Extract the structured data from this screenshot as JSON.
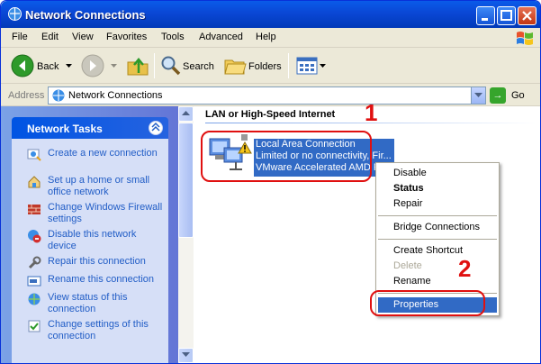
{
  "window": {
    "title": "Network Connections"
  },
  "menubar": [
    "File",
    "Edit",
    "View",
    "Favorites",
    "Tools",
    "Advanced",
    "Help"
  ],
  "toolbar": {
    "back": "Back",
    "search": "Search",
    "folders": "Folders"
  },
  "address": {
    "label": "Address",
    "value": "Network Connections",
    "go": "Go"
  },
  "tasks": {
    "title": "Network Tasks",
    "items": [
      {
        "label": "Create a new connection",
        "icon": "new-connection-icon"
      },
      {
        "label": "Set up a home or small office network",
        "icon": "home-network-icon"
      },
      {
        "label": "Change Windows Firewall settings",
        "icon": "firewall-icon"
      },
      {
        "label": "Disable this network device",
        "icon": "disable-device-icon"
      },
      {
        "label": "Repair this connection",
        "icon": "repair-icon"
      },
      {
        "label": "Rename this connection",
        "icon": "rename-icon"
      },
      {
        "label": "View status of this connection",
        "icon": "status-icon"
      },
      {
        "label": "Change settings of this connection",
        "icon": "settings-icon"
      }
    ]
  },
  "content": {
    "group_title": "LAN or High-Speed Internet",
    "connection": {
      "name": "Local Area Connection",
      "status": "Limited or no connectivity, Fir...",
      "device": "VMware Accelerated AMD P..."
    }
  },
  "context_menu": {
    "items": [
      "Disable",
      "Status",
      "Repair",
      "Bridge Connections",
      "Create Shortcut",
      "Delete",
      "Rename",
      "Properties"
    ]
  },
  "annotations": {
    "step1": "1",
    "step2": "2"
  },
  "colors": {
    "titlebar": "#0a47d5",
    "selection": "#316ac5",
    "annotation": "#e01010",
    "task_link": "#215dc6"
  }
}
